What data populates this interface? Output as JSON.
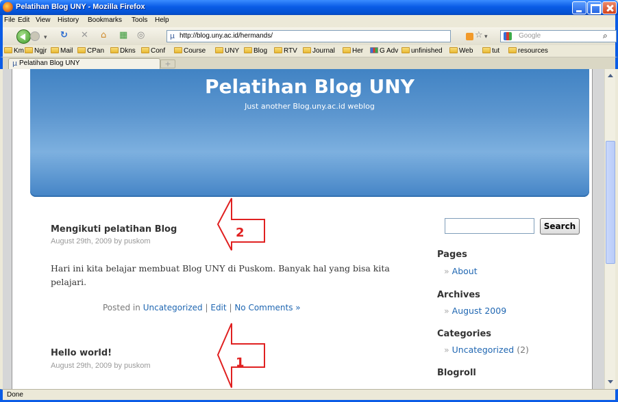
{
  "window": {
    "title": "Pelatihan Blog UNY - Mozilla Firefox"
  },
  "menu": [
    "File",
    "Edit",
    "View",
    "History",
    "Bookmarks",
    "Tools",
    "Help"
  ],
  "nav": {
    "url": "http://blog.uny.ac.id/hermands/",
    "search_placeholder": "Google"
  },
  "bookmarks": [
    "Km",
    "Ngjr",
    "Mail",
    "CPan",
    "Dkns",
    "Conf",
    "Course",
    "UNY",
    "Blog",
    "RTV",
    "Journal",
    "Her",
    "G Adv",
    "unfinished",
    "Web",
    "tut",
    "resources"
  ],
  "tab": {
    "label": "Pelatihan Blog UNY"
  },
  "blog": {
    "title": "Pelatihan Blog UNY",
    "description": "Just another Blog.uny.ac.id weblog"
  },
  "posts": [
    {
      "title": "Mengikuti pelatihan Blog",
      "meta": "August 29th, 2009 by puskom",
      "body": "Hari ini kita belajar membuat Blog UNY di Puskom. Banyak hal yang bisa kita pelajari.",
      "footer": {
        "prefix": "Posted in",
        "category": "Uncategorized",
        "sep": "|",
        "edit": "Edit",
        "comments": "No Comments »"
      }
    },
    {
      "title": "Hello world!",
      "meta": "August 29th, 2009 by puskom"
    }
  ],
  "sidebar": {
    "search_button": "Search",
    "pages": {
      "heading": "Pages",
      "items": [
        "About"
      ]
    },
    "archives": {
      "heading": "Archives",
      "items": [
        "August 2009"
      ]
    },
    "categories": {
      "heading": "Categories",
      "items": [
        "Uncategorized"
      ],
      "count": "(2)"
    },
    "blogroll": {
      "heading": "Blogroll"
    },
    "bullet": "»"
  },
  "annotations": [
    {
      "number": "2"
    },
    {
      "number": "1"
    }
  ],
  "status": {
    "text": "Done"
  },
  "colors": {
    "accent": "#e02020",
    "header": "#4183c4",
    "link": "#2067b2"
  }
}
